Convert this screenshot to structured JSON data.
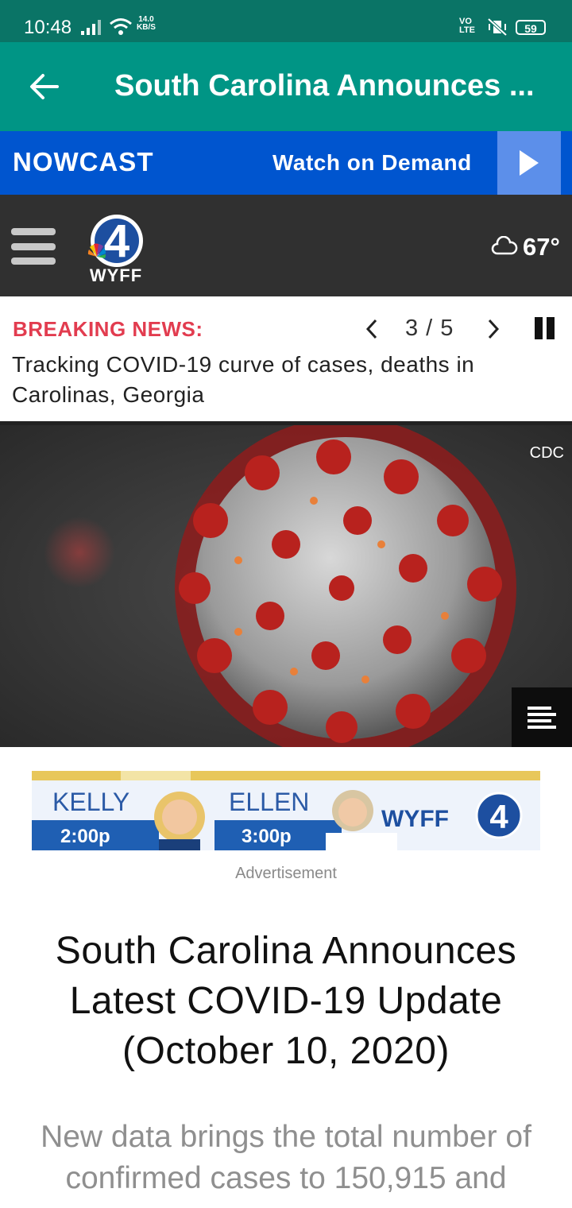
{
  "status_bar": {
    "time": "10:48",
    "speed_value": "14.0",
    "speed_unit": "KB/S",
    "network_line1": "VO",
    "network_line2": "LTE",
    "battery": "59"
  },
  "app_bar": {
    "title": "South Carolina Announces ...",
    "back_icon": "arrow-left-icon"
  },
  "nowcast_bar": {
    "brand": "NOWCAST",
    "watch_label": "Watch on Demand",
    "play_icon": "play-icon"
  },
  "site_header": {
    "logo_text": "WYFF",
    "logo_number": "4",
    "temperature": "67°",
    "weather_icon": "cloud-icon"
  },
  "breaking_news": {
    "label": "BREAKING NEWS:",
    "counter": "3 / 5",
    "headline": "Tracking COVID-19 curve of cases, deaths in Carolinas, Georgia"
  },
  "hero_image": {
    "credit": "CDC"
  },
  "advertisement": {
    "host1": "KELLY",
    "time1": "2:00p",
    "host2": "ELLEN",
    "time2": "3:00p",
    "brand": "WYFF",
    "label": "Advertisement"
  },
  "article": {
    "title": "South Carolina Announces Latest COVID-19 Update (October 10, 2020)",
    "subtitle": "New data brings the total number of confirmed cases to 150,915 and"
  },
  "colors": {
    "status_bar": "#0a7466",
    "app_bar": "#009585",
    "nowcast_bar": "#0055cf",
    "breaking_label": "#e23c4f",
    "header_bg": "#303030"
  }
}
